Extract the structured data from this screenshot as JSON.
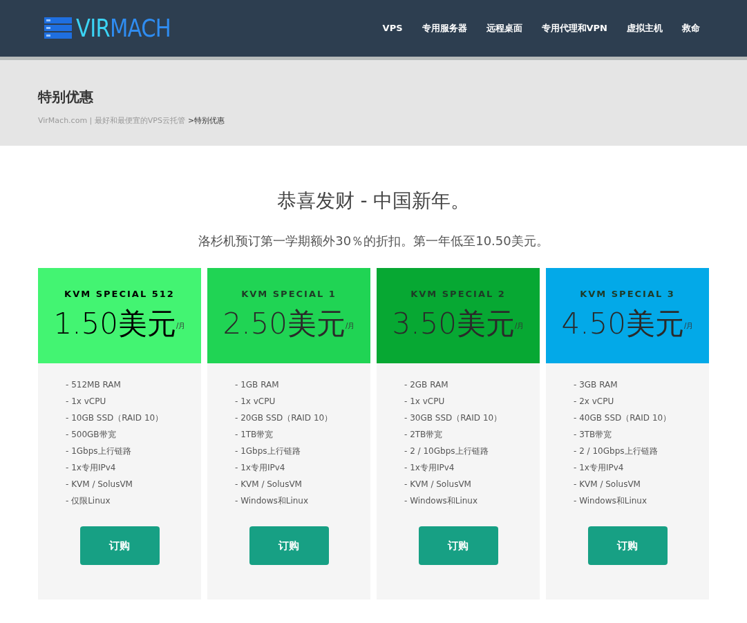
{
  "logo": {
    "part_1": "VIR",
    "part_2": "MACH"
  },
  "nav": [
    "VPS",
    "专用服务器",
    "远程桌面",
    "专用代理和VPN",
    "虚拟主机",
    "救命"
  ],
  "page_title": "特别优惠",
  "breadcrumb": {
    "link": "VirMach.com | 最好和最便宜的VPS云托管",
    "current": ">特别优惠"
  },
  "headline": "恭喜发财 - 中国新年。",
  "subheadline": "洛杉机预订第一学期额外30％的折扣。第一年低至10.50美元。",
  "plans": [
    {
      "name": "KVM SPECIAL 512",
      "color": "#43f472",
      "price": "1.50美元",
      "period": "/月",
      "features": [
        "- 512MB RAM",
        "- 1x vCPU",
        "- 10GB SSD（RAID 10）",
        "- 500GB带宽",
        "- 1Gbps上行链路",
        "- 1x专用IPv4",
        "- KVM / SolusVM",
        "- 仅限Linux"
      ],
      "button": "订购"
    },
    {
      "name": "KVM SPECIAL 1",
      "color": "#20d454",
      "price": "2.50美元",
      "period": "/月",
      "features": [
        "- 1GB RAM",
        "- 1x vCPU",
        "- 20GB SSD（RAID 10）",
        "- 1TB带宽",
        "- 1Gbps上行链路",
        "- 1x专用IPv4",
        "- KVM / SolusVM",
        "- Windows和Linux"
      ],
      "button": "订购"
    },
    {
      "name": "KVM SPECIAL 2",
      "color": "#07a833",
      "price": "3.50美元",
      "period": "/月",
      "features": [
        "- 2GB RAM",
        "- 1x vCPU",
        "- 30GB SSD（RAID 10）",
        "- 2TB带宽",
        "- 2 / 10Gbps上行链路",
        "- 1x专用IPv4",
        "- KVM / SolusVM",
        "- Windows和Linux"
      ],
      "button": "订购"
    },
    {
      "name": "KVM SPECIAL 3",
      "color": "#03a9e8",
      "price": "4.50美元",
      "period": "/月",
      "features": [
        "- 3GB RAM",
        "- 2x vCPU",
        "- 40GB SSD（RAID 10）",
        "- 3TB带宽",
        "- 2 / 10Gbps上行链路",
        "- 1x专用IPv4",
        "- KVM / SolusVM",
        "- Windows和Linux"
      ],
      "button": "订购"
    }
  ]
}
